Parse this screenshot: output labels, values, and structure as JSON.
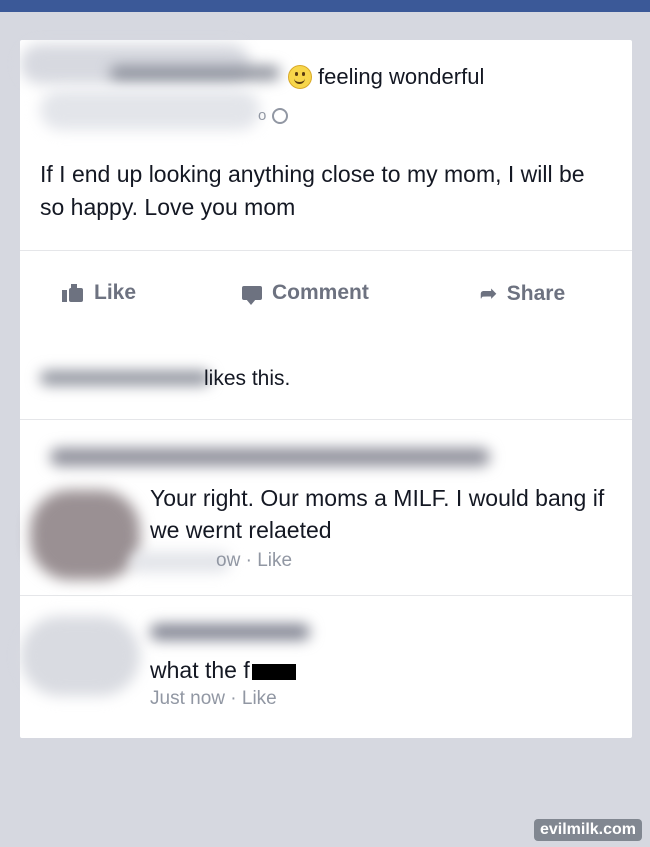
{
  "post": {
    "feeling": "feeling wonderful",
    "meta_fragment": "o",
    "text": "If I end up looking anything close to my mom, I will be so happy. Love you mom"
  },
  "actions": {
    "like": "Like",
    "comment": "Comment",
    "share": "Share"
  },
  "likes": {
    "text": "likes this."
  },
  "comments": [
    {
      "text": "Your right. Our moms a MILF. I would bang if we wernt relaeted",
      "time_fragment": "ow",
      "separator": "·",
      "like": "Like"
    },
    {
      "text": "what the f",
      "time": "Just now",
      "separator": "·",
      "like": "Like"
    }
  ],
  "watermark": "evilmilk.com",
  "colors": {
    "accent": "#3b5998",
    "background": "#d6d8e0",
    "meta": "#9197a3",
    "action": "#6d7280"
  }
}
